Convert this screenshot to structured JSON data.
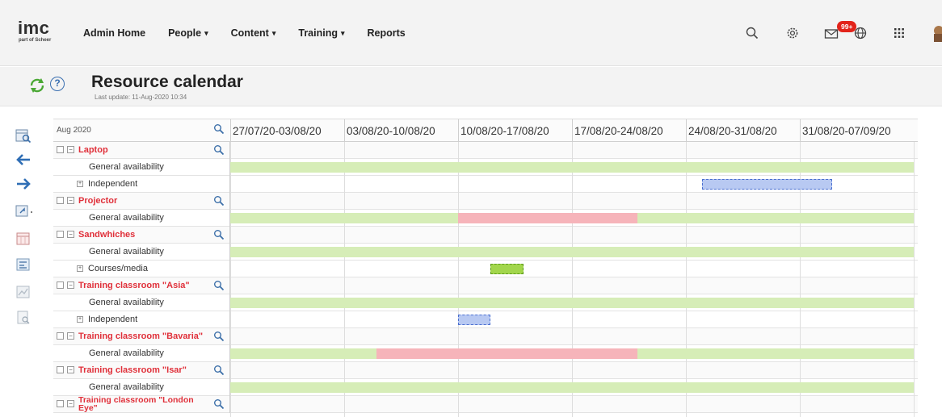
{
  "app": {
    "logo_text": "imc",
    "logo_sub": "part of Scheer"
  },
  "nav": {
    "items": [
      {
        "label": "Admin Home",
        "dropdown": false
      },
      {
        "label": "People",
        "dropdown": true
      },
      {
        "label": "Content",
        "dropdown": true
      },
      {
        "label": "Training",
        "dropdown": true
      },
      {
        "label": "Reports",
        "dropdown": false
      }
    ],
    "icons": [
      "search-icon",
      "settings-icon",
      "messages-icon",
      "language-icon",
      "apps-grid-icon",
      "user-avatar"
    ],
    "messages_badge": "99+",
    "caret": "▾"
  },
  "page": {
    "title": "Resource calendar",
    "last_update": "Last update: 11-Aug-2020 10:34",
    "help_label": "?"
  },
  "toolbar": {
    "tools": [
      "calendar-view-icon",
      "previous-arrow-icon",
      "next-arrow-icon",
      "export-icon",
      "calendar-icon",
      "resource-planning-icon",
      "chart-icon",
      "report-icon"
    ]
  },
  "calendar": {
    "month": "Aug 2020",
    "weeks": [
      "27/07/20-03/08/20",
      "03/08/20-10/08/20",
      "10/08/20-17/08/20",
      "17/08/20-24/08/20",
      "24/08/20-31/08/20",
      "31/08/20-07/09/20"
    ],
    "rows": [
      {
        "kind": "resource",
        "label": "Laptop"
      },
      {
        "kind": "availability",
        "label": "General availability"
      },
      {
        "kind": "subgroup",
        "label": "Independent"
      },
      {
        "kind": "resource",
        "label": "Projector"
      },
      {
        "kind": "availability",
        "label": "General availability"
      },
      {
        "kind": "resource",
        "label": "Sandwhiches"
      },
      {
        "kind": "availability",
        "label": "General availability"
      },
      {
        "kind": "subgroup",
        "label": "Courses/media"
      },
      {
        "kind": "resource",
        "label": "Training classroom \"Asia\""
      },
      {
        "kind": "availability",
        "label": "General availability"
      },
      {
        "kind": "subgroup",
        "label": "Independent"
      },
      {
        "kind": "resource",
        "label": "Training classroom \"Bavaria\""
      },
      {
        "kind": "availability",
        "label": "General availability"
      },
      {
        "kind": "resource",
        "label": "Training classroom \"Isar\""
      },
      {
        "kind": "availability",
        "label": "General availability"
      },
      {
        "kind": "resource",
        "label": "Training classroom \"London Eye\""
      }
    ],
    "bars": [
      {
        "row": 1,
        "type": "available",
        "start": "27/07/20",
        "end": "07/09/20"
      },
      {
        "row": 2,
        "type": "booking",
        "start": "25/08/20",
        "end": "02/09/20"
      },
      {
        "row": 4,
        "type": "available",
        "start": "27/07/20",
        "end": "10/08/20"
      },
      {
        "row": 4,
        "type": "unavailable",
        "start": "10/08/20",
        "end": "21/08/20"
      },
      {
        "row": 4,
        "type": "available",
        "start": "21/08/20",
        "end": "07/09/20"
      },
      {
        "row": 6,
        "type": "available",
        "start": "27/07/20",
        "end": "07/09/20"
      },
      {
        "row": 7,
        "type": "media-booking",
        "start": "12/08/20",
        "end": "14/08/20"
      },
      {
        "row": 9,
        "type": "available",
        "start": "27/07/20",
        "end": "07/09/20"
      },
      {
        "row": 10,
        "type": "booking",
        "start": "10/08/20",
        "end": "12/08/20"
      },
      {
        "row": 12,
        "type": "available",
        "start": "27/07/20",
        "end": "05/08/20"
      },
      {
        "row": 12,
        "type": "unavailable",
        "start": "05/08/20",
        "end": "21/08/20"
      },
      {
        "row": 12,
        "type": "available",
        "start": "21/08/20",
        "end": "07/09/20"
      },
      {
        "row": 14,
        "type": "available",
        "start": "27/07/20",
        "end": "07/09/20"
      }
    ],
    "colors": {
      "available": "#d6edb7",
      "unavailable": "#f6b4ba",
      "booking": "#b8c9f2",
      "media-booking": "#a2d64c",
      "resource_name": "#e0303a"
    }
  }
}
